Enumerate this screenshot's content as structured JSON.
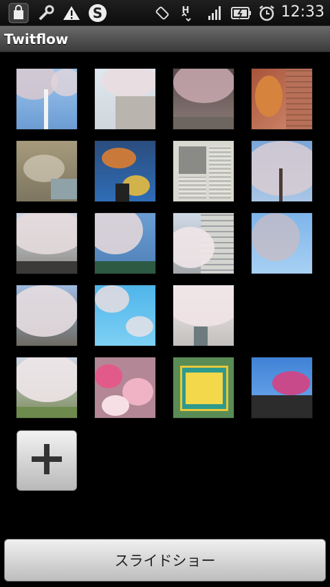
{
  "status_bar": {
    "time": "12:33",
    "icons": [
      "bag-icon",
      "wrench-icon",
      "warning-icon",
      "skype-icon",
      "rotate-icon",
      "data-h-icon",
      "signal-icon",
      "battery-icon",
      "alarm-icon"
    ]
  },
  "app": {
    "title": "Twitflow"
  },
  "gallery": {
    "thumbnails": [
      "cherry-tree-tower",
      "cherry-building",
      "cherry-street",
      "dog-photo",
      "blurry-flowers",
      "picnic-tarp",
      "newspaper-page",
      "cherry-park",
      "cherry-avenue",
      "cherry-blossom-sky",
      "cherry-apartment",
      "cherry-blue-sky",
      "cherry-branch",
      "cherry-sky-light",
      "cherry-canal",
      "cherry-field",
      "pink-plum",
      "no-entry-sign",
      "plum-house"
    ],
    "add_button_icon": "plus-icon"
  },
  "footer": {
    "slideshow_label": "スライドショー"
  },
  "colors": {
    "titlebar": "#555555",
    "background": "#000000",
    "button": "#d8d8d8"
  }
}
